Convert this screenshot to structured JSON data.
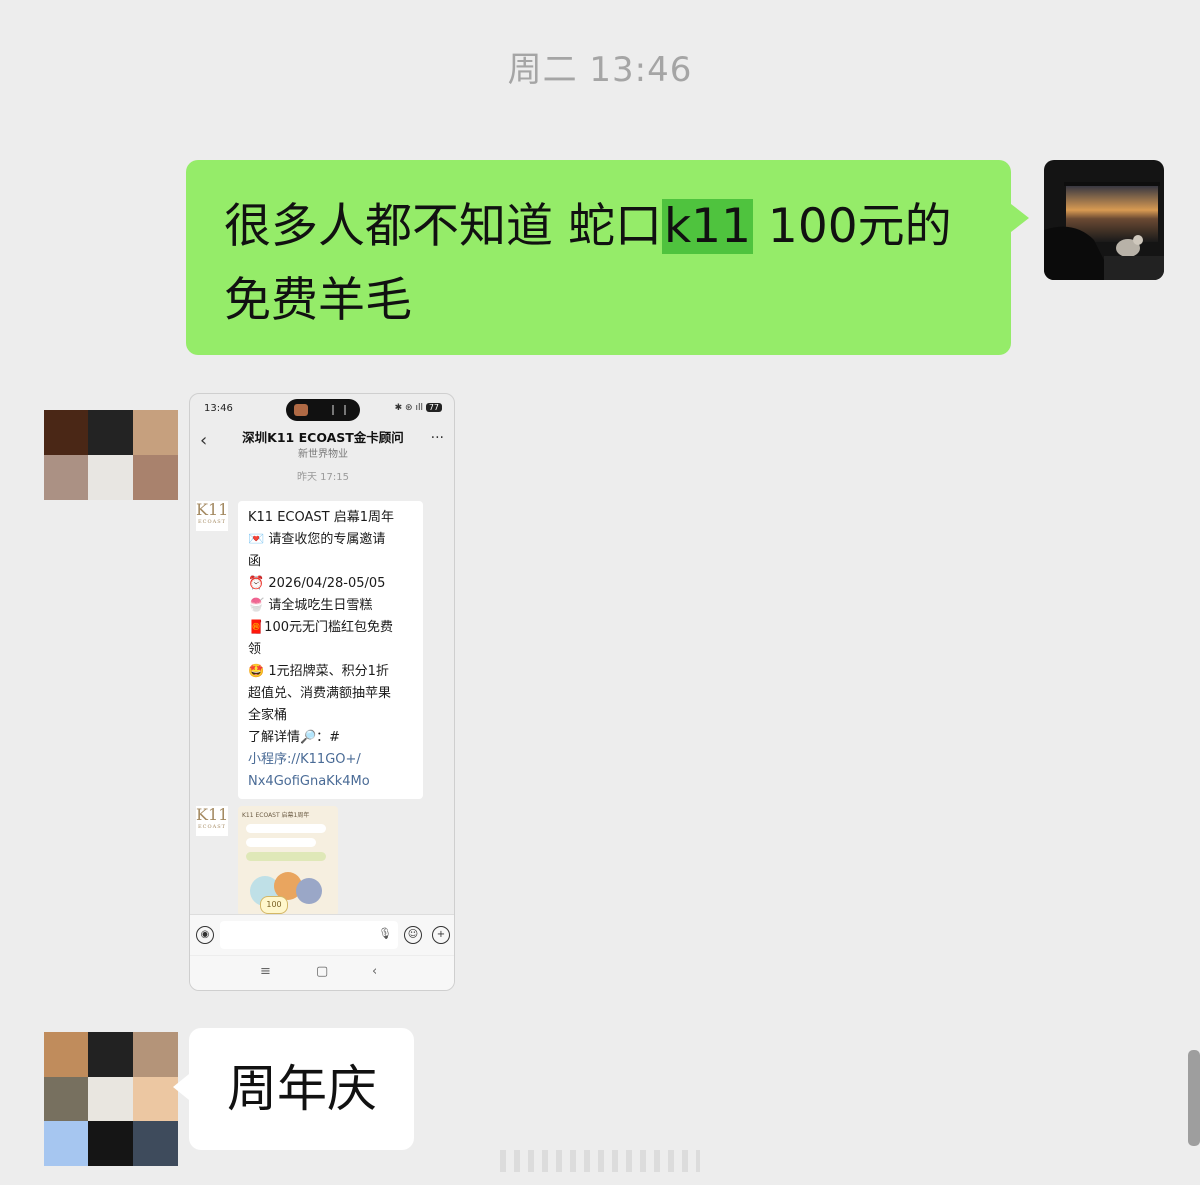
{
  "chat": {
    "timestamp": "周二 13:46",
    "outgoing": {
      "line1_pre": "很多人都不知道 蛇口",
      "line1_highlight": "k11",
      "line1_post": " 100元的",
      "line2": "免费羊毛"
    },
    "incoming_text": "周年庆"
  },
  "screenshot": {
    "status_time": "13:46",
    "status_battery": "77",
    "chat_title": "深圳K11 ECOAST金卡顾问",
    "chat_subtitle": "新世界物业",
    "msg_time": "昨天 17:15",
    "logo_main": "K11",
    "logo_sub": "ECOAST",
    "message_lines": [
      "K11 ECOAST 启幕1周年",
      "💌 请查收您的专属邀请",
      "函",
      "⏰ 2026/04/28-05/05",
      "🍧 请全城吃生日雪糕",
      "🧧100元无门槛红包免费",
      "领",
      "🤩 1元招牌菜、积分1折",
      "超值兑、消费满额抽苹果",
      "全家桶",
      "了解详情🔎：#"
    ],
    "link_lines": [
      "小程序://K11GO+/",
      "Nx4GofiGnaKk4Mo"
    ],
    "card_title": "K11 ECOAST 启幕1周年",
    "card_coin": "100",
    "nav_icons": [
      "menu-icon",
      "home-icon",
      "back-icon"
    ]
  },
  "colors": {
    "background": "#ededed",
    "outgoing_bubble": "#95ec69",
    "highlight": "#4fc33e",
    "incoming_bubble": "#ffffff",
    "timestamp": "#a5a5a5"
  }
}
